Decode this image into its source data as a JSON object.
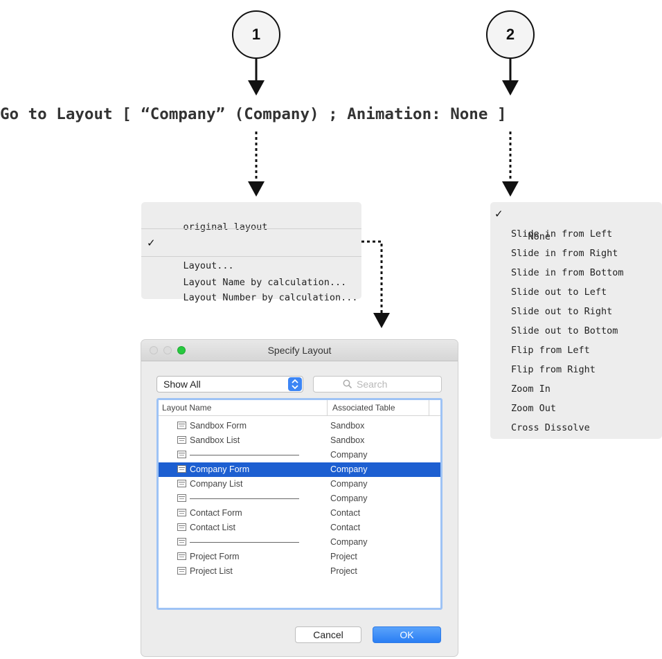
{
  "callouts": [
    "1",
    "2"
  ],
  "script_line": "Go to Layout [ “Company” (Company) ; Animation: None ]",
  "layout_menu": {
    "items": [
      {
        "label": "original layout",
        "checked": false
      },
      {
        "label": "Layout...",
        "checked": true
      },
      {
        "label": "Layout Name by calculation...",
        "checked": false
      },
      {
        "label": "Layout Number by calculation...",
        "checked": false
      }
    ]
  },
  "animation_menu": {
    "items": [
      {
        "label": "None",
        "checked": true
      },
      {
        "label": "Slide in from Left",
        "checked": false
      },
      {
        "label": "Slide in from Right",
        "checked": false
      },
      {
        "label": "Slide in from Bottom",
        "checked": false
      },
      {
        "label": "Slide out to Left",
        "checked": false
      },
      {
        "label": "Slide out to Right",
        "checked": false
      },
      {
        "label": "Slide out to Bottom",
        "checked": false
      },
      {
        "label": "Flip from Left",
        "checked": false
      },
      {
        "label": "Flip from Right",
        "checked": false
      },
      {
        "label": "Zoom In",
        "checked": false
      },
      {
        "label": "Zoom Out",
        "checked": false
      },
      {
        "label": "Cross Dissolve",
        "checked": false
      }
    ]
  },
  "check_glyph": "✓",
  "dialog": {
    "title": "Specify Layout",
    "show_popup": "Show All",
    "search_placeholder": "Search",
    "columns": [
      "Layout Name",
      "Associated Table"
    ],
    "rows": [
      {
        "name": "Sandbox Form",
        "table": "Sandbox",
        "separator": false,
        "selected": false
      },
      {
        "name": "Sandbox List",
        "table": "Sandbox",
        "separator": false,
        "selected": false
      },
      {
        "name": "",
        "table": "Company",
        "separator": true,
        "selected": false
      },
      {
        "name": "Company Form",
        "table": "Company",
        "separator": false,
        "selected": true
      },
      {
        "name": "Company List",
        "table": "Company",
        "separator": false,
        "selected": false
      },
      {
        "name": "",
        "table": "Company",
        "separator": true,
        "selected": false
      },
      {
        "name": "Contact Form",
        "table": "Contact",
        "separator": false,
        "selected": false
      },
      {
        "name": "Contact List",
        "table": "Contact",
        "separator": false,
        "selected": false
      },
      {
        "name": "",
        "table": "Company",
        "separator": true,
        "selected": false
      },
      {
        "name": "Project Form",
        "table": "Project",
        "separator": false,
        "selected": false
      },
      {
        "name": "Project List",
        "table": "Project",
        "separator": false,
        "selected": false
      }
    ],
    "cancel_label": "Cancel",
    "ok_label": "OK"
  },
  "colors": {
    "selection": "#1d5fd1",
    "accent_button": "#2a7ef3",
    "traffic_green": "#27c93f"
  }
}
